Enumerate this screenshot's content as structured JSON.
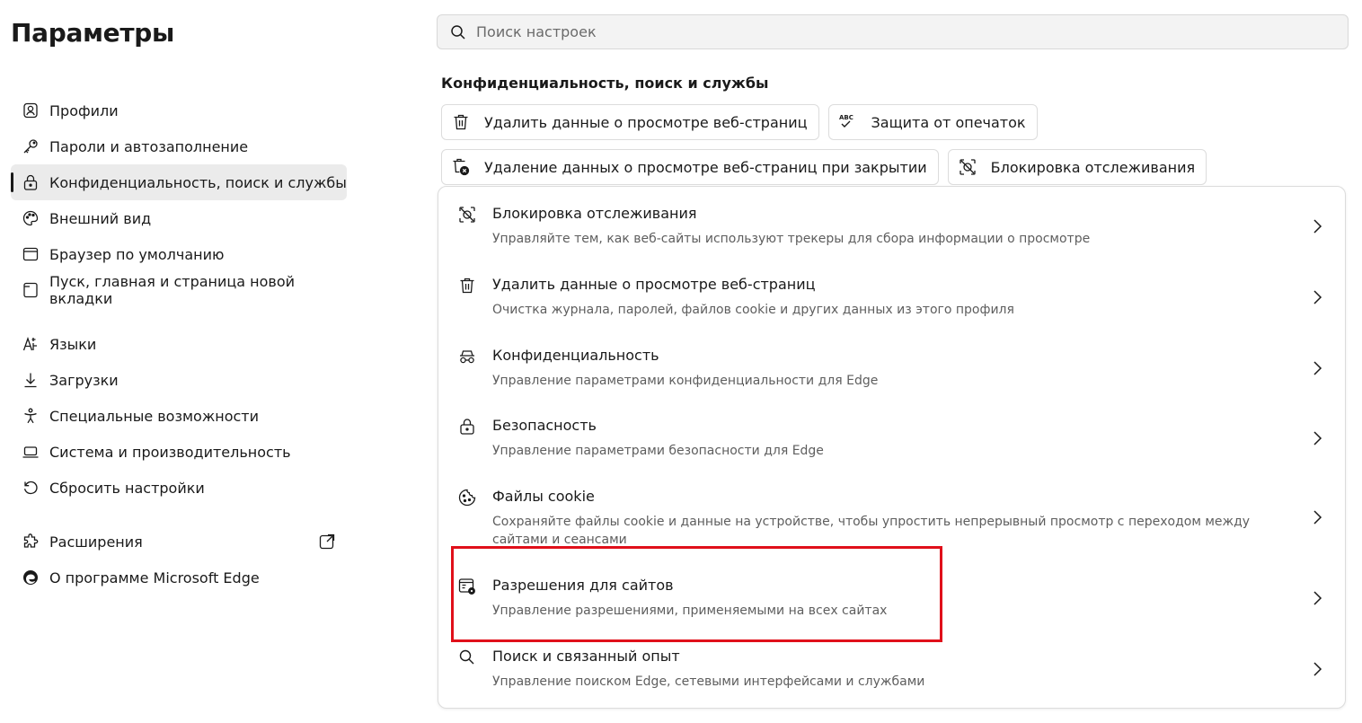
{
  "app": {
    "title": "Параметры"
  },
  "search": {
    "placeholder": "Поиск настроек"
  },
  "sidebar": {
    "items": [
      {
        "label": "Профили",
        "icon": "profile-icon"
      },
      {
        "label": "Пароли и автозаполнение",
        "icon": "key-icon"
      },
      {
        "label": "Конфиденциальность, поиск и службы",
        "icon": "lock-icon",
        "active": true
      },
      {
        "label": "Внешний вид",
        "icon": "palette-icon"
      },
      {
        "label": "Браузер по умолчанию",
        "icon": "browser-icon"
      },
      {
        "label": "Пуск, главная и страница новой вкладки",
        "icon": "new-tab-icon"
      },
      {
        "label": "Языки",
        "icon": "languages-icon"
      },
      {
        "label": "Загрузки",
        "icon": "download-icon"
      },
      {
        "label": "Специальные возможности",
        "icon": "accessibility-icon"
      },
      {
        "label": "Система и производительность",
        "icon": "laptop-icon"
      },
      {
        "label": "Сбросить настройки",
        "icon": "reset-icon"
      },
      {
        "label": "Расширения",
        "icon": "puzzle-icon",
        "external": true
      },
      {
        "label": "О программе Microsoft Edge",
        "icon": "edge-logo-icon"
      }
    ]
  },
  "section": {
    "title": "Конфиденциальность, поиск и службы"
  },
  "chips": [
    {
      "label": "Удалить данные о просмотре веб-страниц",
      "icon": "trash-icon"
    },
    {
      "label": "Защита от опечаток",
      "icon": "spellcheck-icon",
      "icon_text": "ABC"
    },
    {
      "label": "Удаление данных о просмотре веб-страниц при закрытии",
      "icon": "trash-clock-icon"
    },
    {
      "label": "Блокировка отслеживания",
      "icon": "tracking-prevention-icon"
    }
  ],
  "rows": [
    {
      "title": "Блокировка отслеживания",
      "desc": "Управляйте тем, как веб-сайты используют трекеры для сбора информации о просмотре",
      "icon": "tracking-prevention-icon"
    },
    {
      "title": "Удалить данные о просмотре веб-страниц",
      "desc": "Очистка журнала, паролей, файлов cookie и других данных из этого профиля",
      "icon": "trash-icon"
    },
    {
      "title": "Конфиденциальность",
      "desc": "Управление параметрами конфиденциальности для Edge",
      "icon": "incognito-icon"
    },
    {
      "title": "Безопасность",
      "desc": "Управление параметрами безопасности для Edge",
      "icon": "lock-icon"
    },
    {
      "title": "Файлы cookie",
      "desc": "Сохраняйте файлы cookie и данные на устройстве, чтобы упростить непрерывный просмотр с переходом между сайтами и сеансами",
      "icon": "cookie-icon"
    },
    {
      "title": "Разрешения для сайтов",
      "desc": "Управление разрешениями, применяемыми на всех сайтах",
      "icon": "site-permissions-icon",
      "highlighted": true
    },
    {
      "title": "Поиск и связанный опыт",
      "desc": "Управление поиском Edge, сетевыми интерфейсами и службами",
      "icon": "search-icon"
    }
  ],
  "colors": {
    "highlight": "#e0101a",
    "active_bg": "#ebebeb",
    "text": "#1a1a1a",
    "muted": "#5e5e5e"
  }
}
